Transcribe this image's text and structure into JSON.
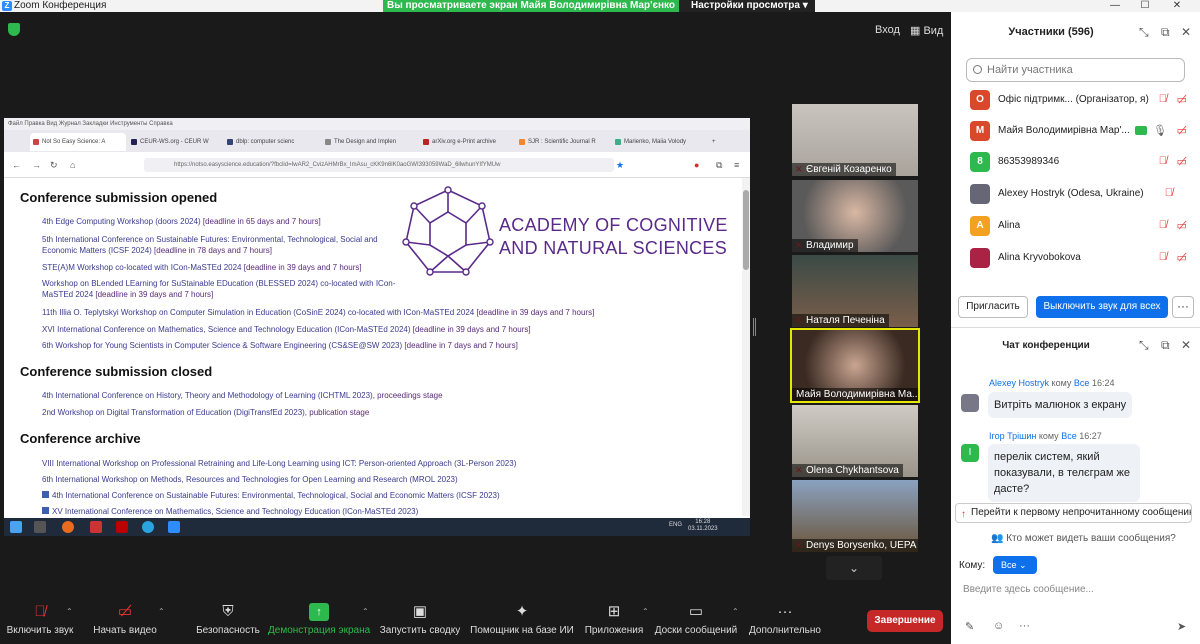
{
  "app": {
    "title": "Zoom Конференция",
    "banner": "Вы просматриваете экран Майя Володимирівна Мар'єнко",
    "view_options": "Настройки просмотра",
    "login": "Вход",
    "view": "Вид"
  },
  "browser": {
    "menu": "Файл   Правка   Вид   Журнал   Закладки   Инструменты   Справка",
    "tabs": [
      "Not So Easy Science: A",
      "CEUR-WS.org - CEUR W",
      "dblp: computer scienc",
      "The Design and Implen",
      "arXiv.org e-Print archive",
      "SJR : Scientific Journal R",
      "Marienko, Maiia Volody"
    ],
    "url": "https://notso.easyscience.education/?fbclid=IwAR2_CvizAHMrBx_ImAsu_cKK9n6lK0aoGWI393059WaD_6llwhunYIfYMUw"
  },
  "page": {
    "academy_line1": "ACADEMY OF COGNITIVE",
    "academy_line2": "AND NATURAL SCIENCES",
    "h_opened": "Conference submission opened",
    "h_closed": "Conference submission closed",
    "h_archive": "Conference archive",
    "opened": [
      {
        "t": "4th Edge Computing Workshop (doors 2024)",
        "d": "[deadline in 65 days and 7 hours]"
      },
      {
        "t": "5th International Conference on Sustainable Futures: Environmental, Technological, Social and",
        "t2": "Economic Matters (ICSF 2024)",
        "d": "[deadline in 78 days and 7 hours]"
      },
      {
        "t": "STE(A)M Workshop co-located with ICon-MaSTEd 2024",
        "d": "[deadline in 39 days and 7 hours]"
      },
      {
        "t": "Workshop on BLended LEarning for SuStainable EDucation (BLESSED 2024) co-located with ICon-",
        "t2": "MaSTEd 2024",
        "d": "[deadline in 39 days and 7 hours]"
      },
      {
        "t": "11th Illia O. Teplytskyi Workshop on Computer Simulation in Education (CoSinE 2024) co-located with ICon-MaSTEd 2024",
        "d": "[deadline in 39 days and 7 hours]"
      },
      {
        "t": "XVI International Conference on Mathematics, Science and Technology Education (ICon-MaSTEd 2024)",
        "d": "[deadline in 39 days and 7 hours]"
      },
      {
        "t": "6th Workshop for Young Scientists in Computer Science & Software Engineering (CS&SE@SW 2023)",
        "d": "[deadline in 7 days and 7 hours]"
      }
    ],
    "closed": [
      {
        "t": "4th International Conference on History, Theory and Methodology of Learning (ICHTML 2023),",
        "d": "proceedings stage"
      },
      {
        "t": "2nd Workshop on Digital Transformation of Education (DigiTransfEd 2023),",
        "d": "publication stage"
      }
    ],
    "archive": [
      "VIII International Workshop on Professional Retraining and Life-Long Learning using ICT: Person-oriented Approach (3L-Person 2023)",
      "6th International Workshop on Methods, Resources and Technologies for Open Learning and Research (MROL 2023)",
      "4th International Conference on Sustainable Futures: Environmental, Technological, Social and Economic Matters (ICSF 2023)",
      "XV International Conference on Mathematics, Science and Technology Education (ICon-MaSTEd 2023)"
    ]
  },
  "taskbar": {
    "lang": "ENG",
    "time": "16:28",
    "date": "03.11.2023"
  },
  "tiles": [
    "Євгеній Козаренко",
    "Владимир",
    "Наталя Печеніна",
    "Майя Володимирівна Ма...",
    "Olena Chykhantsova",
    "Denys Borysenko, UEPA"
  ],
  "participants": {
    "title": "Участники (596)",
    "search_placeholder": "Найти участника",
    "list": [
      {
        "av": "О",
        "color": "#d9482b",
        "name": "Офіс підтримк... (Організатор, я)"
      },
      {
        "av": "М",
        "color": "#d9482b",
        "name": "Майя Володимирівна Мар'..."
      },
      {
        "av": "8",
        "color": "#2db94d",
        "name": "86353989346"
      },
      {
        "av": "",
        "color": "#667",
        "name": "Alexey Hostryk (Odesa, Ukraine)"
      },
      {
        "av": "A",
        "color": "#f4a020",
        "name": "Alina"
      },
      {
        "av": "",
        "color": "#a24",
        "name": "Alina Kryvobokova"
      }
    ],
    "invite": "Пригласить",
    "mute_all": "Выключить звук для всех",
    "more": "···"
  },
  "chat": {
    "title": "Чат конференции",
    "m1_from": "Alexey Hostryk",
    "m1_to": "кому",
    "m1_all": "Все",
    "m1_time": "16:24",
    "m1_text": "Витріть малюнок з екрану",
    "m2_from": "Ігор Трішин",
    "m2_to": "кому",
    "m2_all": "Все",
    "m2_time": "16:27",
    "m2_l1": "перелік систем, який",
    "m2_l2": "показували, в телєграм же",
    "m2_l3": "дасте?",
    "unread": "Перейти к первому непрочитанному сообщению",
    "who": "Кто может видеть ваши сообщения?",
    "to": "Кому:",
    "to_value": "Все",
    "placeholder": "Введите здесь сообщение..."
  },
  "toolbar": [
    "Включить звук",
    "Начать видео",
    "Безопасность",
    "Демонстрация экрана",
    "Запустить сводку",
    "Помощник на базе ИИ",
    "Приложения",
    "Доски сообщений",
    "Дополнительно"
  ],
  "end": "Завершение"
}
